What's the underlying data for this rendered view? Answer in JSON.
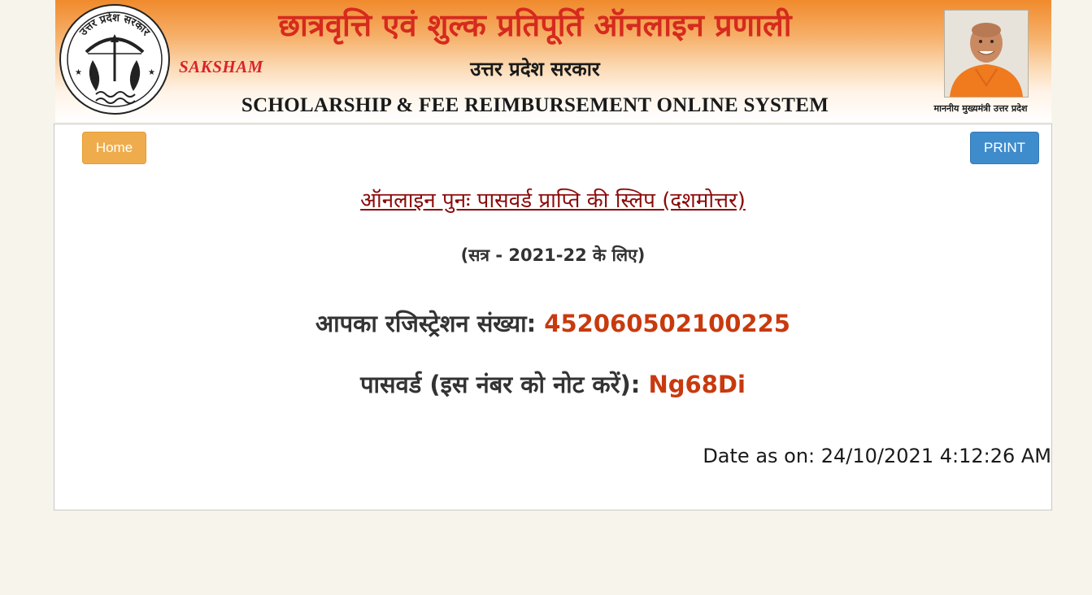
{
  "header": {
    "title_hindi": "छात्रवृत्ति एवं शुल्क प्रतिपूर्ति ऑनलाइन प्रणाली",
    "brand": "SAKSHAM",
    "subtitle_hindi": "उत्तर प्रदेश सरकार",
    "title_english": "SCHOLARSHIP & FEE REIMBURSEMENT ONLINE SYSTEM",
    "emblem_text": "उत्तर प्रदेश सरकार",
    "cm_caption": "माननीय मुख्यमंत्री  उत्तर प्रदेश",
    "colors": {
      "banner_orange": "#f08a2c",
      "title_red": "#d62a1e"
    }
  },
  "toolbar": {
    "home_label": "Home",
    "print_label": "PRINT",
    "home_color": "#efac4d",
    "print_color": "#3f8ccd"
  },
  "slip": {
    "title": "ऑनलाइन पुनः पासवर्ड प्राप्ति की स्लिप (दशमोत्तर)",
    "session": "(सत्र - 2021-22 के लिए)",
    "registration_label": "आपका रजिस्ट्रेशन संख्या:",
    "registration_number": "452060502100225",
    "password_label": "पासवर्ड (इस नंबर को नोट करें):",
    "password_value": "Ng68Di",
    "date_text": "Date as on: 24/10/2021 4:12:26 AM",
    "colors": {
      "title": "#8b0b0b",
      "value": "#c83a0e"
    }
  }
}
